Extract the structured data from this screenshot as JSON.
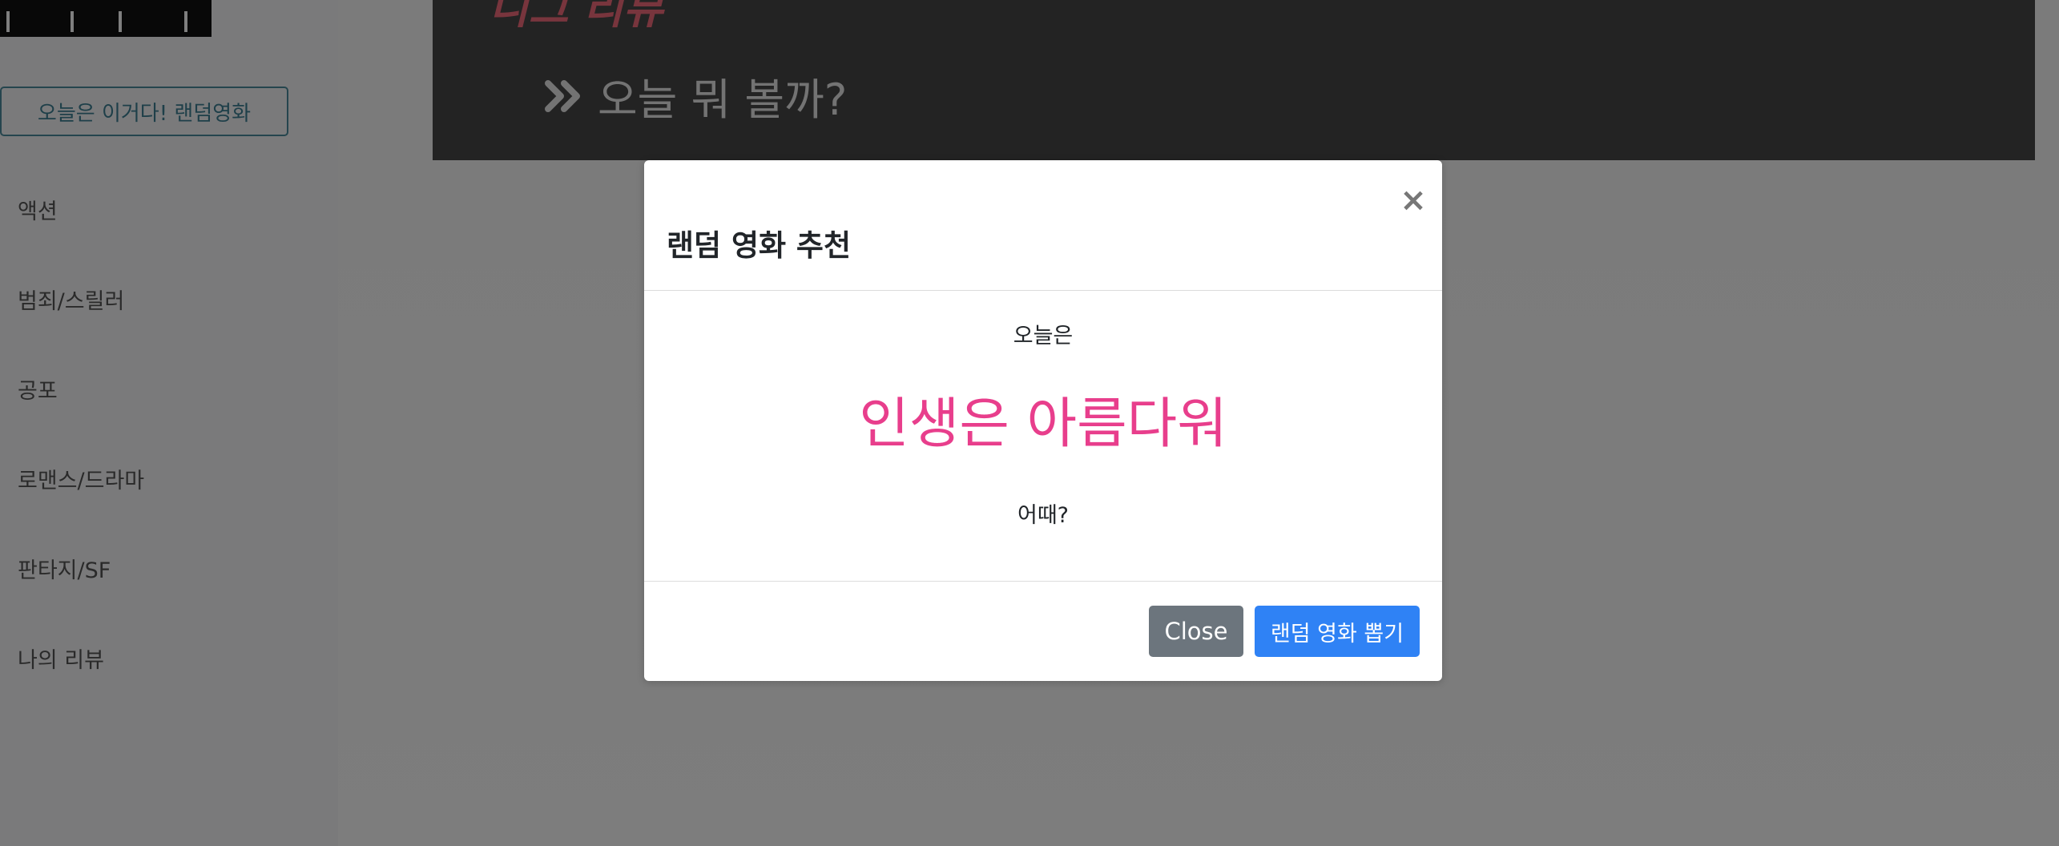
{
  "sidebar": {
    "random_button_label": "오늘은 이거다! 랜덤영화",
    "items": [
      {
        "label": "액션"
      },
      {
        "label": "범죄/스릴러"
      },
      {
        "label": "공포"
      },
      {
        "label": "로맨스/드라마"
      },
      {
        "label": "판타지/SF"
      },
      {
        "label": "나의 리뷰"
      }
    ]
  },
  "main": {
    "hero_title_partial": "니그 리뷰",
    "hero_subtitle": "오늘 뭐 볼까?"
  },
  "modal": {
    "title": "랜덤 영화 추천",
    "close_symbol": "×",
    "body_intro": "오늘은",
    "movie_title": "인생은 아름다워",
    "body_outro": "어때?",
    "close_button_label": "Close",
    "pick_button_label": "랜덤 영화 뽑기"
  },
  "colors": {
    "accent_pink": "#e83e8c",
    "primary_blue": "#2f82f5",
    "secondary_gray": "#6c757d",
    "outline_teal": "#3c7f93"
  },
  "icons": {
    "hero_chevron": "double-chevron-right-icon",
    "modal_close": "close-icon"
  }
}
